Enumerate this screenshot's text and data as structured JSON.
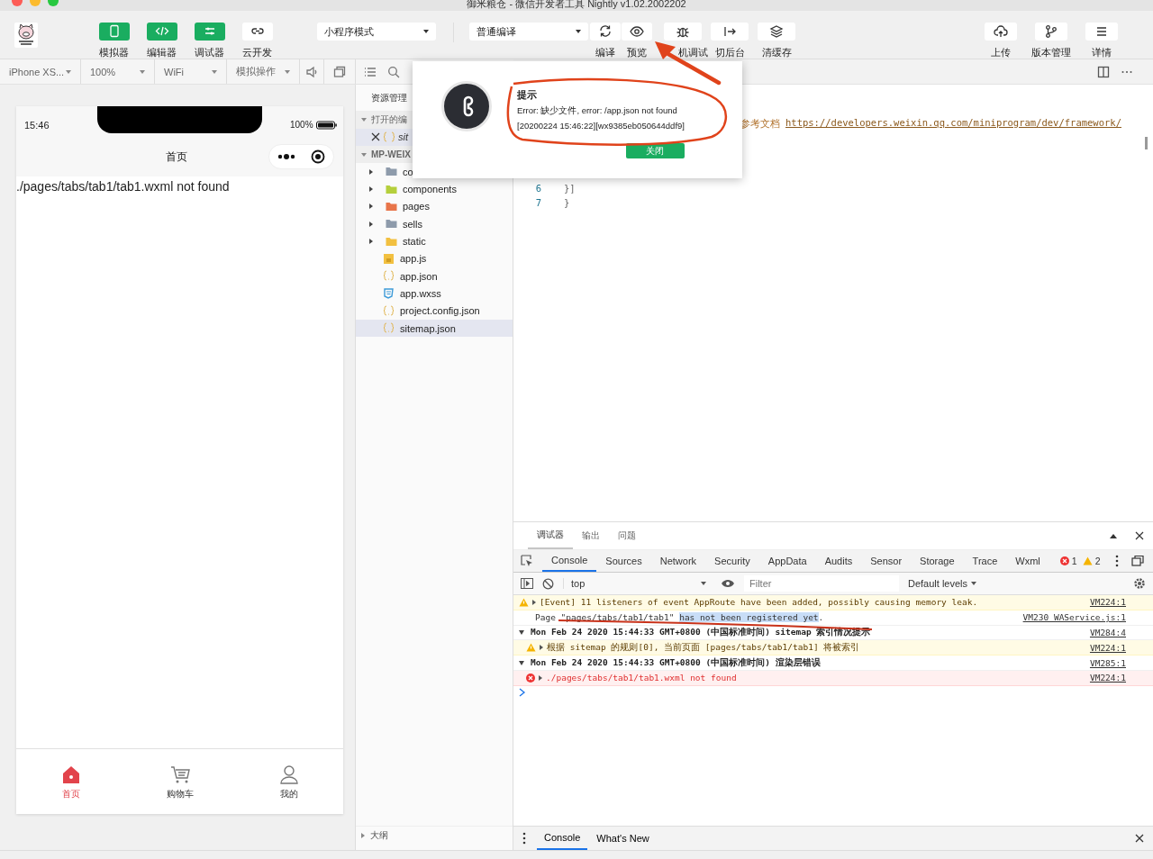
{
  "window": {
    "title": "御米粮仓 - 微信开发者工具 Nightly v1.02.2002202"
  },
  "toolbar": {
    "mode_buttons": [
      {
        "label": "模拟器",
        "on": true
      },
      {
        "label": "编辑器",
        "on": true
      },
      {
        "label": "调试器",
        "on": true
      },
      {
        "label": "云开发",
        "on": false
      }
    ],
    "mode_select": "小程序模式",
    "compile_select": "普通编译",
    "actions": [
      {
        "label": "编译"
      },
      {
        "label": "预览"
      },
      {
        "label": "机调试"
      },
      {
        "label": "切后台"
      },
      {
        "label": "清缓存"
      }
    ],
    "right_actions": [
      {
        "label": "上传"
      },
      {
        "label": "版本管理"
      },
      {
        "label": "详情"
      }
    ]
  },
  "simulator": {
    "controls": [
      "iPhone XS...",
      "100%",
      "WiFi",
      "模拟操作"
    ],
    "time": "15:46",
    "battery": "100%",
    "nav_title": "首页",
    "page_text": "./pages/tabs/tab1/tab1.wxml not found",
    "tabbar": [
      {
        "label": "首页",
        "selected": true
      },
      {
        "label": "购物车",
        "selected": false
      },
      {
        "label": "我的",
        "selected": false
      }
    ]
  },
  "explorer": {
    "title": "资源管理",
    "open_editors": "打开的编",
    "open_file": "sit",
    "project": "MP-WEIX",
    "items": [
      {
        "name": "co",
        "kind": "folder",
        "color": "#8e9bab",
        "selected": false
      },
      {
        "name": "components",
        "kind": "folder",
        "color": "#b5cf3c",
        "selected": false
      },
      {
        "name": "pages",
        "kind": "folder",
        "color": "#e8754a",
        "selected": false
      },
      {
        "name": "sells",
        "kind": "folder",
        "color": "#8e9bab",
        "selected": false
      },
      {
        "name": "static",
        "kind": "folder",
        "color": "#f2c040",
        "selected": false
      },
      {
        "name": "app.js",
        "kind": "js",
        "selected": false
      },
      {
        "name": "app.json",
        "kind": "json",
        "selected": false
      },
      {
        "name": "app.wxss",
        "kind": "css",
        "selected": false
      },
      {
        "name": "project.config.json",
        "kind": "json",
        "selected": false
      },
      {
        "name": "sitemap.json",
        "kind": "json",
        "selected": true
      }
    ],
    "outline": "大纲"
  },
  "editor": {
    "doc_text": "参考文档",
    "doc_link": "https://developers.weixin.qq.com/miniprogram/dev/framework/",
    "lines": [
      {
        "number": "6",
        "text": "}]"
      },
      {
        "number": "7",
        "text": "}"
      }
    ]
  },
  "dialog": {
    "title": "提示",
    "message": "Error: 缺少文件, error: /app.json not found",
    "detail": "[20200224 15:46:22][wx9385eb050644ddf9]",
    "button": "关闭"
  },
  "devtools": {
    "panel_tabs": [
      {
        "label": "调试器",
        "selected": true
      },
      {
        "label": "输出",
        "selected": false
      },
      {
        "label": "问题",
        "selected": false
      }
    ],
    "tabs": [
      {
        "label": "Console",
        "selected": true
      },
      {
        "label": "Sources",
        "selected": false
      },
      {
        "label": "Network",
        "selected": false
      },
      {
        "label": "Security",
        "selected": false
      },
      {
        "label": "AppData",
        "selected": false
      },
      {
        "label": "Audits",
        "selected": false
      },
      {
        "label": "Sensor",
        "selected": false
      },
      {
        "label": "Storage",
        "selected": false
      },
      {
        "label": "Trace",
        "selected": false
      },
      {
        "label": "Wxml",
        "selected": false
      }
    ],
    "errors": "1",
    "warnings": "2",
    "context": "top",
    "filter_placeholder": "Filter",
    "levels": "Default levels",
    "messages": [
      {
        "kind": "warning",
        "parts": [
          {
            "text": "[Event] 11 listeners of event AppRoute have been added, possibly causing memory leak.",
            "highlighted": false
          }
        ],
        "source": "VM224:1"
      },
      {
        "kind": "info",
        "parts": [
          {
            "text": "Page \"pages/tabs/tab1/tab1\" ",
            "highlighted": false
          },
          {
            "text": "has not been registered yet",
            "highlighted": true
          },
          {
            "text": ".",
            "highlighted": false
          }
        ],
        "source": "VM230 WAService.js:1"
      },
      {
        "kind": "group",
        "parts": [
          {
            "text": "Mon Feb 24 2020 15:44:33 GMT+0800 (中国标准时间) sitemap 索引情况提示",
            "highlighted": false
          }
        ],
        "source": "VM284:4"
      },
      {
        "kind": "warning",
        "parts": [
          {
            "text": "根据 sitemap 的规则[0], 当前页面 [pages/tabs/tab1/tab1] 将被索引",
            "highlighted": false
          }
        ],
        "source": "VM224:1"
      },
      {
        "kind": "group",
        "parts": [
          {
            "text": "Mon Feb 24 2020 15:44:33 GMT+0800 (中国标准时间) 渲染层错误",
            "highlighted": false
          }
        ],
        "source": "VM285:1"
      },
      {
        "kind": "error",
        "parts": [
          {
            "text": "./pages/tabs/tab1/tab1.wxml not found",
            "highlighted": false
          }
        ],
        "source": "VM224:1"
      }
    ],
    "drawer_tabs": [
      {
        "label": "Console",
        "selected": true
      },
      {
        "label": "What's New",
        "selected": false
      }
    ]
  }
}
